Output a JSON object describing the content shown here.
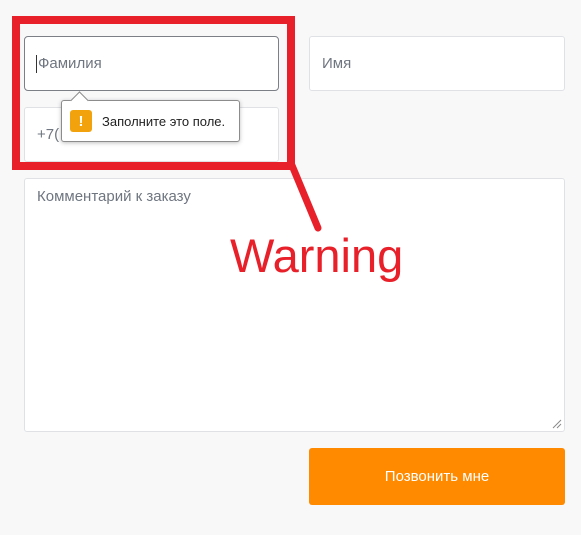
{
  "form": {
    "lastname_placeholder": "Фамилия",
    "firstname_placeholder": "Имя",
    "phone_value": "+7(",
    "comment_placeholder": "Комментарий к заказу",
    "submit_label": "Позвонить мне"
  },
  "validation_tooltip": {
    "icon": "exclamation-warning-icon",
    "icon_symbol": "!",
    "message": "Заполните это поле.",
    "icon_color": "#f2a20c"
  },
  "annotation": {
    "label": "Warning",
    "color": "#e8202a"
  },
  "colors": {
    "button": "#ff8a00",
    "background": "#f8f8f9"
  }
}
